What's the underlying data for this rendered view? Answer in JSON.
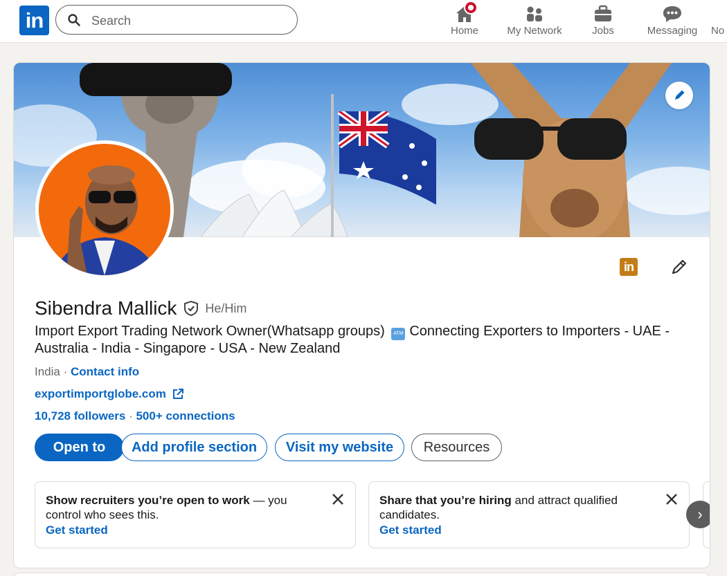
{
  "nav": {
    "logo_text": "in",
    "search_placeholder": "Search",
    "items": [
      {
        "label": "Home",
        "icon": "home-icon",
        "has_notification": true
      },
      {
        "label": "My Network",
        "icon": "people-icon"
      },
      {
        "label": "Jobs",
        "icon": "briefcase-icon"
      },
      {
        "label": "Messaging",
        "icon": "chat-icon"
      },
      {
        "label": "No",
        "icon": "bell-icon"
      }
    ]
  },
  "profile": {
    "name": "Sibendra Mallick",
    "pronouns": "He/Him",
    "headline_part1": "Import Export Trading Network Owner(Whatsapp groups)",
    "headline_emoji": "ATM",
    "headline_part2": "Connecting Exporters to Importers - UAE - Australia - India - Singapore - USA - New Zealand",
    "location": "India",
    "location_sep": " · ",
    "contact_info": "Contact info",
    "website": "exportimportglobe.com",
    "followers": "10,728 followers",
    "stats_sep": " · ",
    "connections": "500+ connections",
    "brand_badge": "in"
  },
  "actions": {
    "open_to": "Open to",
    "add_section": "Add profile section",
    "visit_website": "Visit my website",
    "resources": "Resources"
  },
  "promos": [
    {
      "bold": "Show recruiters you’re open to work",
      "rest": " — you control who sees this.",
      "cta": "Get started"
    },
    {
      "bold": "Share that you’re hiring",
      "rest": " and attract qualified candidates.",
      "cta": "Get started"
    }
  ],
  "carousel_next": "›",
  "colors": {
    "brand": "#0a66c2",
    "avatar_bg": "#f26a0c",
    "badge": "#c37d16",
    "notification": "#cb112d"
  }
}
